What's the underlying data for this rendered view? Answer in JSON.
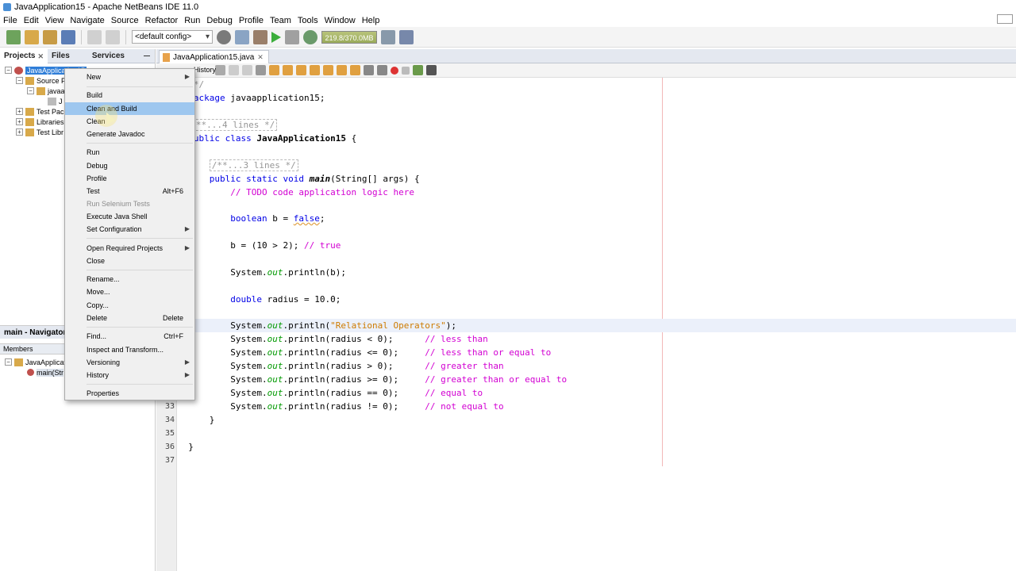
{
  "window": {
    "title": "JavaApplication15 - Apache NetBeans IDE 11.0"
  },
  "menubar": [
    "File",
    "Edit",
    "View",
    "Navigate",
    "Source",
    "Refactor",
    "Run",
    "Debug",
    "Profile",
    "Team",
    "Tools",
    "Window",
    "Help"
  ],
  "toolbar": {
    "config": "<default config>",
    "memory": "219.8/370.0MB"
  },
  "left_panel": {
    "tabs": [
      "Projects",
      "Files",
      "Services"
    ],
    "tree": [
      {
        "label": "JavaApplication15",
        "selected": true
      },
      {
        "label": "Source P"
      },
      {
        "label": "javaa"
      },
      {
        "label": "J"
      },
      {
        "label": "Test Pack"
      },
      {
        "label": "Libraries"
      },
      {
        "label": "Test Libr"
      }
    ]
  },
  "navigator": {
    "title": "main - Navigator",
    "members_label": "Members",
    "items": [
      "JavaApplicat",
      "main(Str"
    ]
  },
  "editor": {
    "tab_label": "JavaApplication15.java",
    "history_label": "History",
    "line_numbers": [
      "33",
      "34",
      "35",
      "36",
      "37"
    ]
  },
  "code": {
    "l1": " */",
    "l2_kw": "package",
    "l2_rest": " javaapplication15;",
    "l3_fold": "/**...4 lines */",
    "l4_kw1": "public",
    "l4_kw2": " class",
    "l4_name": " JavaApplication15",
    "l4_rest": " {",
    "l5_fold": "/**...3 lines */",
    "l6_kw": "public static void",
    "l6_m": " main",
    "l6_rest": "(String[] args) {",
    "l7": "// TODO code application logic here",
    "l8_kw": "boolean",
    "l8_mid": " b = ",
    "l8_val": "false",
    "l8_end": ";",
    "l9_code": "b = (10 > 2); ",
    "l9_cmt": "// true",
    "l10_a": "System.",
    "l10_f": "out",
    "l10_b": ".println(b);",
    "l11_kw": "double",
    "l11_rest": " radius = 10.0;",
    "l12_a": "System.",
    "l12_f": "out",
    "l12_b": ".println(",
    "l12_s": "\"Relational Operators\"",
    "l12_c": ");",
    "cmp_lines": [
      {
        "a": "System.",
        "f": "out",
        "b": ".println(radius < 0);      ",
        "c": "// less than"
      },
      {
        "a": "System.",
        "f": "out",
        "b": ".println(radius <= 0);     ",
        "c": "// less than or equal to"
      },
      {
        "a": "System.",
        "f": "out",
        "b": ".println(radius > 0);      ",
        "c": "// greater than"
      },
      {
        "a": "System.",
        "f": "out",
        "b": ".println(radius >= 0);     ",
        "c": "// greater than or equal to"
      },
      {
        "a": "System.",
        "f": "out",
        "b": ".println(radius == 0);     ",
        "c": "// equal to"
      },
      {
        "a": "System.",
        "f": "out",
        "b": ".println(radius != 0);     ",
        "c": "// not equal to"
      }
    ],
    "close1": "}",
    "close2": "}"
  },
  "context_menu": {
    "items": [
      {
        "label": "New",
        "submenu": true
      },
      {
        "label": "Build"
      },
      {
        "label": "Clean and Build",
        "highlighted": true
      },
      {
        "label": "Clean"
      },
      {
        "label": "Generate Javadoc"
      },
      {
        "label": "Run"
      },
      {
        "label": "Debug"
      },
      {
        "label": "Profile"
      },
      {
        "label": "Test",
        "accel": "Alt+F6"
      },
      {
        "label": "Run Selenium Tests",
        "disabled": true
      },
      {
        "label": "Execute Java Shell"
      },
      {
        "label": "Set Configuration",
        "submenu": true
      },
      {
        "label": "Open Required Projects",
        "submenu": true
      },
      {
        "label": "Close"
      },
      {
        "label": "Rename..."
      },
      {
        "label": "Move..."
      },
      {
        "label": "Copy..."
      },
      {
        "label": "Delete",
        "accel": "Delete"
      },
      {
        "label": "Find...",
        "accel": "Ctrl+F"
      },
      {
        "label": "Inspect and Transform..."
      },
      {
        "label": "Versioning",
        "submenu": true
      },
      {
        "label": "History",
        "submenu": true
      },
      {
        "label": "Properties"
      }
    ]
  }
}
